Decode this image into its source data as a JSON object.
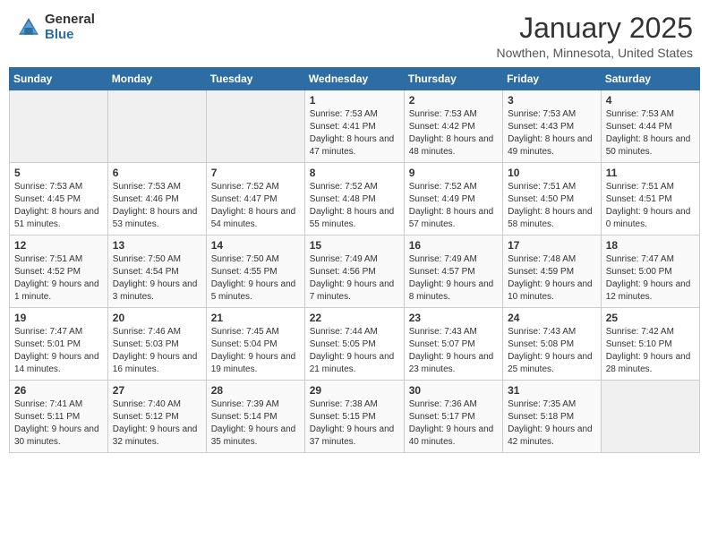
{
  "header": {
    "logo_general": "General",
    "logo_blue": "Blue",
    "month_title": "January 2025",
    "location": "Nowthen, Minnesota, United States"
  },
  "days_of_week": [
    "Sunday",
    "Monday",
    "Tuesday",
    "Wednesday",
    "Thursday",
    "Friday",
    "Saturday"
  ],
  "weeks": [
    [
      {
        "day": "",
        "content": ""
      },
      {
        "day": "",
        "content": ""
      },
      {
        "day": "",
        "content": ""
      },
      {
        "day": "1",
        "content": "Sunrise: 7:53 AM\nSunset: 4:41 PM\nDaylight: 8 hours and 47 minutes."
      },
      {
        "day": "2",
        "content": "Sunrise: 7:53 AM\nSunset: 4:42 PM\nDaylight: 8 hours and 48 minutes."
      },
      {
        "day": "3",
        "content": "Sunrise: 7:53 AM\nSunset: 4:43 PM\nDaylight: 8 hours and 49 minutes."
      },
      {
        "day": "4",
        "content": "Sunrise: 7:53 AM\nSunset: 4:44 PM\nDaylight: 8 hours and 50 minutes."
      }
    ],
    [
      {
        "day": "5",
        "content": "Sunrise: 7:53 AM\nSunset: 4:45 PM\nDaylight: 8 hours and 51 minutes."
      },
      {
        "day": "6",
        "content": "Sunrise: 7:53 AM\nSunset: 4:46 PM\nDaylight: 8 hours and 53 minutes."
      },
      {
        "day": "7",
        "content": "Sunrise: 7:52 AM\nSunset: 4:47 PM\nDaylight: 8 hours and 54 minutes."
      },
      {
        "day": "8",
        "content": "Sunrise: 7:52 AM\nSunset: 4:48 PM\nDaylight: 8 hours and 55 minutes."
      },
      {
        "day": "9",
        "content": "Sunrise: 7:52 AM\nSunset: 4:49 PM\nDaylight: 8 hours and 57 minutes."
      },
      {
        "day": "10",
        "content": "Sunrise: 7:51 AM\nSunset: 4:50 PM\nDaylight: 8 hours and 58 minutes."
      },
      {
        "day": "11",
        "content": "Sunrise: 7:51 AM\nSunset: 4:51 PM\nDaylight: 9 hours and 0 minutes."
      }
    ],
    [
      {
        "day": "12",
        "content": "Sunrise: 7:51 AM\nSunset: 4:52 PM\nDaylight: 9 hours and 1 minute."
      },
      {
        "day": "13",
        "content": "Sunrise: 7:50 AM\nSunset: 4:54 PM\nDaylight: 9 hours and 3 minutes."
      },
      {
        "day": "14",
        "content": "Sunrise: 7:50 AM\nSunset: 4:55 PM\nDaylight: 9 hours and 5 minutes."
      },
      {
        "day": "15",
        "content": "Sunrise: 7:49 AM\nSunset: 4:56 PM\nDaylight: 9 hours and 7 minutes."
      },
      {
        "day": "16",
        "content": "Sunrise: 7:49 AM\nSunset: 4:57 PM\nDaylight: 9 hours and 8 minutes."
      },
      {
        "day": "17",
        "content": "Sunrise: 7:48 AM\nSunset: 4:59 PM\nDaylight: 9 hours and 10 minutes."
      },
      {
        "day": "18",
        "content": "Sunrise: 7:47 AM\nSunset: 5:00 PM\nDaylight: 9 hours and 12 minutes."
      }
    ],
    [
      {
        "day": "19",
        "content": "Sunrise: 7:47 AM\nSunset: 5:01 PM\nDaylight: 9 hours and 14 minutes."
      },
      {
        "day": "20",
        "content": "Sunrise: 7:46 AM\nSunset: 5:03 PM\nDaylight: 9 hours and 16 minutes."
      },
      {
        "day": "21",
        "content": "Sunrise: 7:45 AM\nSunset: 5:04 PM\nDaylight: 9 hours and 19 minutes."
      },
      {
        "day": "22",
        "content": "Sunrise: 7:44 AM\nSunset: 5:05 PM\nDaylight: 9 hours and 21 minutes."
      },
      {
        "day": "23",
        "content": "Sunrise: 7:43 AM\nSunset: 5:07 PM\nDaylight: 9 hours and 23 minutes."
      },
      {
        "day": "24",
        "content": "Sunrise: 7:43 AM\nSunset: 5:08 PM\nDaylight: 9 hours and 25 minutes."
      },
      {
        "day": "25",
        "content": "Sunrise: 7:42 AM\nSunset: 5:10 PM\nDaylight: 9 hours and 28 minutes."
      }
    ],
    [
      {
        "day": "26",
        "content": "Sunrise: 7:41 AM\nSunset: 5:11 PM\nDaylight: 9 hours and 30 minutes."
      },
      {
        "day": "27",
        "content": "Sunrise: 7:40 AM\nSunset: 5:12 PM\nDaylight: 9 hours and 32 minutes."
      },
      {
        "day": "28",
        "content": "Sunrise: 7:39 AM\nSunset: 5:14 PM\nDaylight: 9 hours and 35 minutes."
      },
      {
        "day": "29",
        "content": "Sunrise: 7:38 AM\nSunset: 5:15 PM\nDaylight: 9 hours and 37 minutes."
      },
      {
        "day": "30",
        "content": "Sunrise: 7:36 AM\nSunset: 5:17 PM\nDaylight: 9 hours and 40 minutes."
      },
      {
        "day": "31",
        "content": "Sunrise: 7:35 AM\nSunset: 5:18 PM\nDaylight: 9 hours and 42 minutes."
      },
      {
        "day": "",
        "content": ""
      }
    ]
  ]
}
